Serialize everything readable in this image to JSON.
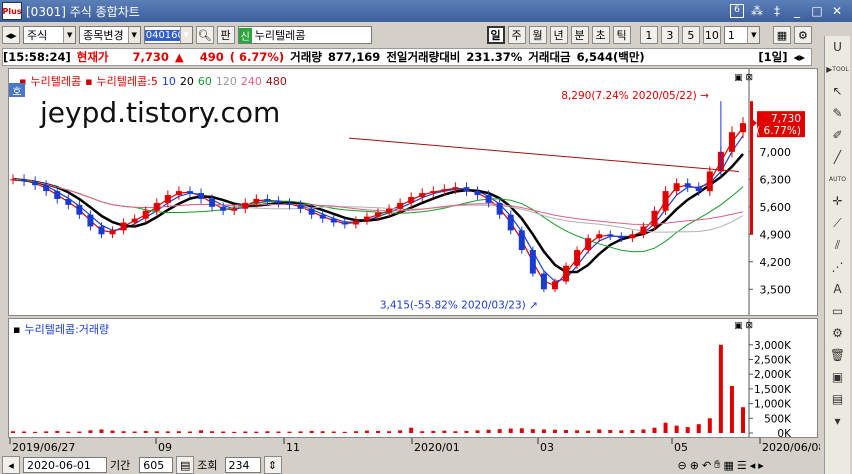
{
  "window": {
    "title": "[0301] 주식 종합차트",
    "logo": "Plus",
    "page_num": "6"
  },
  "toolbar": {
    "market": "주식",
    "change_label": "종목변경",
    "code": "040160",
    "pan": "판",
    "stock_tag": "신",
    "stock_name": "누리텔레콤",
    "periods": [
      "일",
      "주",
      "월",
      "년",
      "분",
      "초",
      "틱"
    ],
    "intervals": [
      "1",
      "3",
      "5",
      "10"
    ],
    "interval_value": "1"
  },
  "info": {
    "time": "[15:58:24]",
    "price_label": "현재가",
    "price": "7,730",
    "arrow": "▲",
    "change": "490",
    "change_pct": "( 6.77%)",
    "volume_label": "거래량",
    "volume": "877,169",
    "prev_ratio_label": "전일거래량대비",
    "prev_ratio": "231.37%",
    "amount_label": "거래대금",
    "amount": "6,544(백만)",
    "period_tag": "[1일]"
  },
  "price_panel": {
    "legend_name": "누리텔레콤",
    "legend_ma_name": "누리텔레콤:5",
    "ma": [
      {
        "label": "10",
        "color": "#2040d0"
      },
      {
        "label": "20",
        "color": "#000000"
      },
      {
        "label": "60",
        "color": "#1a9a2a"
      },
      {
        "label": "120",
        "color": "#b0b0b0"
      },
      {
        "label": "240",
        "color": "#e06080"
      },
      {
        "label": "480",
        "color": "#a01010"
      }
    ],
    "ho": "호",
    "watermark": "jeypd.tistory.com",
    "high_note": "8,290(7.24% 2020/05/22)",
    "low_note": "3,415(-55.82% 2020/03/23)",
    "current_price_tag": "7,730",
    "current_pct_tag": "( 6.77%)"
  },
  "volume_panel": {
    "legend": "누리텔레콤:거래량"
  },
  "x_labels": [
    "2019/06/27",
    "09",
    "11",
    "2020/01",
    "03",
    "05",
    "2020/06/08"
  ],
  "bottom": {
    "date": "2020-06-01",
    "period_label": "기간",
    "period_value": "605",
    "query_label": "조회",
    "query_value": "234"
  },
  "colors": {
    "up": "#e00000",
    "down": "#1a3bd0",
    "accent": "#3c5f9c"
  },
  "chart_data": [
    {
      "type": "candlestick",
      "title": "누리텔레콤",
      "x": [
        "2019/06/27",
        "2019/09",
        "2019/11",
        "2020/01",
        "2020/03",
        "2020/05",
        "2020/06/08"
      ],
      "ylim": [
        3100,
        8600
      ],
      "y_ticks": [
        3500,
        4200,
        4900,
        5600,
        6300,
        7000
      ],
      "close": [
        6300,
        6250,
        6150,
        6000,
        5800,
        5650,
        5400,
        5100,
        4900,
        5000,
        5200,
        5300,
        5500,
        5700,
        5900,
        6000,
        5950,
        5800,
        5600,
        5500,
        5550,
        5700,
        5800,
        5750,
        5700,
        5650,
        5550,
        5400,
        5300,
        5200,
        5150,
        5250,
        5350,
        5450,
        5550,
        5700,
        5850,
        5950,
        6000,
        6050,
        6100,
        6000,
        5900,
        5700,
        5400,
        5000,
        4500,
        3900,
        3500,
        3700,
        4100,
        4500,
        4800,
        4900,
        4850,
        4800,
        4900,
        5100,
        5500,
        6000,
        6200,
        6100,
        6000,
        6500,
        7000,
        7500,
        7730
      ],
      "high_label": 8290,
      "low_label": 3415,
      "last": 7730
    },
    {
      "type": "bar",
      "title": "누리텔레콤:거래량",
      "ylim": [
        0,
        3400000
      ],
      "y_ticks": [
        0,
        500000,
        1000000,
        1500000,
        2000000,
        2500000,
        3000000
      ],
      "y_tick_labels": [
        "0K",
        "500K",
        "1,000K",
        "1,500K",
        "2,000K",
        "2,500K",
        "3,000K"
      ],
      "values": [
        60,
        50,
        40,
        55,
        70,
        45,
        50,
        90,
        120,
        80,
        60,
        50,
        70,
        60,
        55,
        60,
        50,
        90,
        60,
        50,
        40,
        50,
        45,
        60,
        50,
        45,
        55,
        70,
        60,
        50,
        40,
        60,
        80,
        70,
        60,
        90,
        180,
        60,
        70,
        80,
        60,
        70,
        90,
        110,
        130,
        150,
        160,
        130,
        120,
        110,
        100,
        90,
        80,
        120,
        100,
        90,
        100,
        120,
        180,
        350,
        250,
        200,
        300,
        500,
        3000,
        1600,
        877
      ]
    }
  ]
}
